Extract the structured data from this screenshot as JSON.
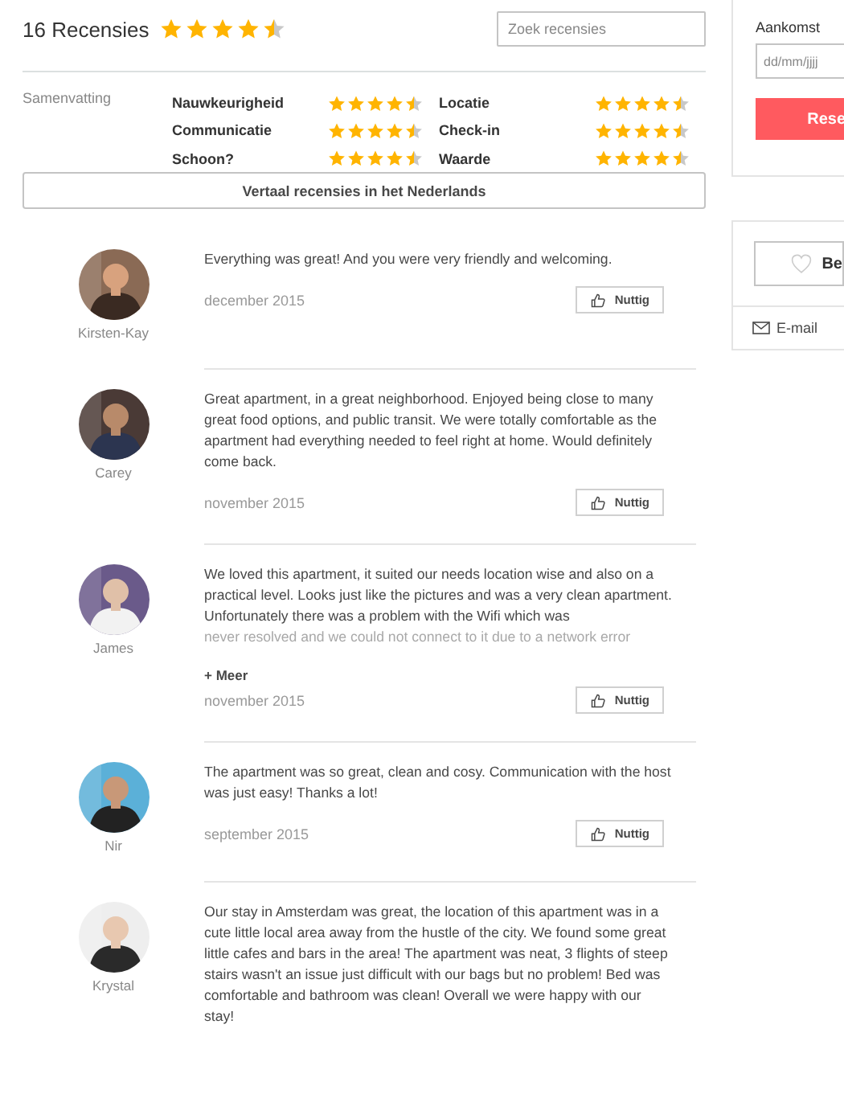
{
  "header": {
    "title": "16 Recensies",
    "stars": 4.5
  },
  "search": {
    "placeholder": "Zoek recensies"
  },
  "summary": {
    "label": "Samenvatting",
    "ratings": [
      {
        "label": "Nauwkeurigheid",
        "stars": 4.5
      },
      {
        "label": "Locatie",
        "stars": 4.5
      },
      {
        "label": "Communicatie",
        "stars": 4.5
      },
      {
        "label": "Check-in",
        "stars": 4.5
      },
      {
        "label": "Schoon?",
        "stars": 4.5
      },
      {
        "label": "Waarde",
        "stars": 4.5
      }
    ]
  },
  "translate_button": "Vertaal recensies in het Nederlands",
  "reviews": [
    {
      "name": "Kirsten-Kay",
      "text": "Everything was great! And you were very friendly and welcoming.",
      "date": "december 2015",
      "helpful": "Nuttig"
    },
    {
      "name": "Carey",
      "text": "Great apartment, in a great neighborhood. Enjoyed being close to many great food options, and public transit. We were totally comfortable as the apartment had everything needed to feel right at home. Would definitely come back.",
      "date": "november 2015",
      "helpful": "Nuttig"
    },
    {
      "name": "James",
      "text": "We loved this apartment, it suited our needs location wise and also on a practical level. Looks just like the pictures and was a very clean apartment. Unfortunately there was a problem with the Wifi which was",
      "faded_text": "never resolved and we could not connect to it due to a network error",
      "more": "+ Meer",
      "date": "november 2015",
      "helpful": "Nuttig"
    },
    {
      "name": "Nir",
      "text": "The apartment was so great, clean and cosy. Communication with the host was just easy! Thanks a lot!",
      "date": "september 2015",
      "helpful": "Nuttig"
    },
    {
      "name": "Krystal",
      "text": "Our stay in Amsterdam was great, the location of this apartment was in a cute little local area away from the hustle of the city. We found some great little cafes and bars in the area! The apartment was neat, 3 flights of steep stairs wasn't an issue just difficult with our bags but no problem! Bed was comfortable and bathroom was clean! Overall we were happy with our stay!"
    }
  ],
  "booking": {
    "arrival_label": "Aankomst",
    "arrival_placeholder": "dd/mm/jjjj",
    "reserve_button": "Rese"
  },
  "actions": {
    "wishlist_button": "Be",
    "email": "E-mail"
  }
}
